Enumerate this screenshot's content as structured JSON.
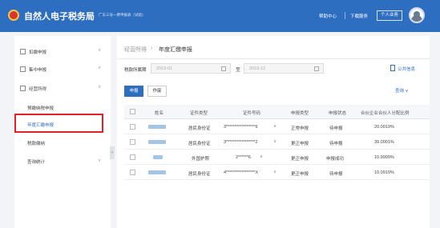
{
  "header": {
    "title": "自然人电子税务局",
    "subtitle": "广东三号一费申报表（试验）",
    "help": "帮助中心",
    "download": "下载服务",
    "user_button": "个人业务"
  },
  "sidebar": {
    "items": [
      {
        "label": "扣缴申报",
        "icon": "clipboard-icon",
        "chevron": "∨"
      },
      {
        "label": "集中申报",
        "icon": "upload-icon",
        "chevron": "∨"
      },
      {
        "label": "经营所得",
        "icon": "briefcase-icon",
        "chevron": "∧"
      }
    ],
    "sub_items": [
      {
        "label": "预缴纳税申报"
      },
      {
        "label": "年度汇缴申报",
        "active": true
      },
      {
        "label": "税款缴纳"
      },
      {
        "label": "查询统计",
        "chevron": "∨"
      }
    ],
    "collapse": "‹"
  },
  "breadcrumb": {
    "parent": "经营所得",
    "sep": "›",
    "current": "年度汇缴申报"
  },
  "filter": {
    "label": "税款所属期",
    "start_placeholder": "2019-01",
    "to": "至",
    "end_placeholder": "2019-12",
    "public_info": "公共信息"
  },
  "actions": {
    "declare": "申报",
    "void": "作废",
    "query": "查询 ∨"
  },
  "table": {
    "columns": [
      "姓名",
      "证件类型",
      "证件号码",
      "申报类型",
      "申报状态",
      "合伙企业合伙人分配比例"
    ],
    "rows": [
      {
        "id_type": "居民身份证",
        "id_no": "3*****************6",
        "decl_type": "正常申报",
        "status": "待申报",
        "ratio": "20.0019%"
      },
      {
        "id_type": "居民身份证",
        "id_no": "3*****************2",
        "decl_type": "更正申报",
        "status": "待申报",
        "ratio": "39.0001%"
      },
      {
        "id_type": "外国护照",
        "id_no": "2******6",
        "decl_type": "更正申报",
        "status": "申报成功",
        "ratio": "10.9999%"
      },
      {
        "id_type": "居民身份证",
        "id_no": "4*****************X",
        "decl_type": "更正申报",
        "status": "待申报",
        "ratio": "10.0919%"
      }
    ]
  }
}
